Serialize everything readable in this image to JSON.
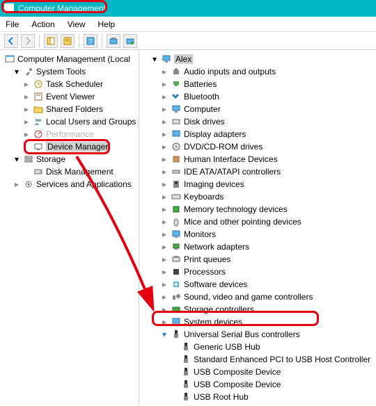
{
  "title": "Computer Management",
  "menu": {
    "file": "File",
    "action": "Action",
    "view": "View",
    "help": "Help"
  },
  "left": {
    "root": "Computer Management (Local",
    "systools": "System Tools",
    "tasksched": "Task Scheduler",
    "eventviewer": "Event Viewer",
    "sharedfolders": "Shared Folders",
    "localusers": "Local Users and Groups",
    "performance": "Performance",
    "devicemgr": "Device Manager",
    "storage": "Storage",
    "diskmgmt": "Disk Management",
    "services": "Services and Applications"
  },
  "right": {
    "computer": "Alex",
    "categories": [
      "Audio inputs and outputs",
      "Batteries",
      "Bluetooth",
      "Computer",
      "Disk drives",
      "Display adapters",
      "DVD/CD-ROM drives",
      "Human Interface Devices",
      "IDE ATA/ATAPI controllers",
      "Imaging devices",
      "Keyboards",
      "Memory technology devices",
      "Mice and other pointing devices",
      "Monitors",
      "Network adapters",
      "Print queues",
      "Processors",
      "Software devices",
      "Sound, video and game controllers",
      "Storage controllers",
      "System devices"
    ],
    "usb": "Universal Serial Bus controllers",
    "usb_children": [
      "Generic USB Hub",
      "Standard Enhanced PCI to USB Host Controller",
      "USB Composite Device",
      "USB Composite Device",
      "USB Root Hub"
    ]
  }
}
